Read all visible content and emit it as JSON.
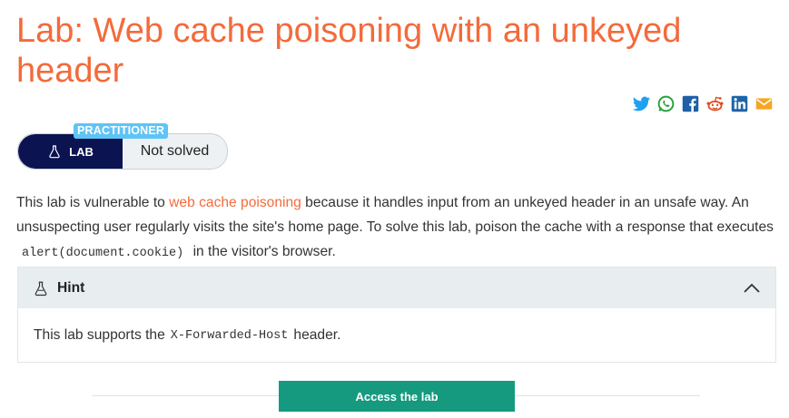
{
  "lab": {
    "title": "Lab: Web cache poisoning with an unkeyed header",
    "level": "PRACTITIONER",
    "lab_badge": "LAB",
    "status": "Not solved"
  },
  "share": {
    "icons": [
      "twitter-icon",
      "whatsapp-icon",
      "facebook-icon",
      "reddit-icon",
      "linkedin-icon",
      "email-icon"
    ]
  },
  "description": {
    "part1": "This lab is vulnerable to ",
    "link": "web cache poisoning",
    "part2": " because it handles input from an unkeyed header in an unsafe way. An unsuspecting user regularly visits the site's home page. To solve this lab, poison the cache with a response that executes ",
    "code": "alert(document.cookie)",
    "part3": " in the visitor's browser."
  },
  "hint": {
    "title": "Hint",
    "text_before": "This lab supports the ",
    "code": "X-Forwarded-Host",
    "text_after": " header."
  },
  "actions": {
    "access_label": "Access the lab"
  },
  "colors": {
    "accent": "#f36b3b",
    "badge_dark": "#0b1350",
    "level_tag": "#5ec4f5",
    "button": "#159a7f"
  }
}
